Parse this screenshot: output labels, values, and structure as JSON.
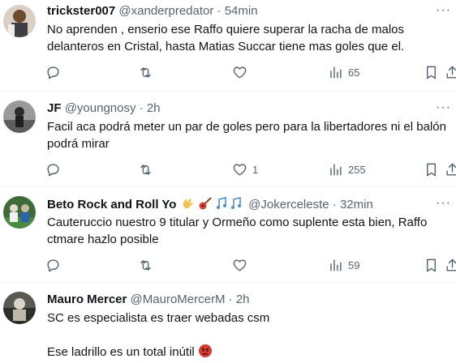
{
  "tweets": [
    {
      "name": "trickster007",
      "handle": "@xanderpredator",
      "dot": "·",
      "time": "54min",
      "text": "No aprenden , enserio ese Raffo quiere superar la racha de malos delanteros en Cristal, hasta Matias Succar tiene mas goles que el.",
      "likes": "",
      "views": "65"
    },
    {
      "name": "JF",
      "handle": "@youngnosy",
      "dot": "·",
      "time": "2h",
      "text": "Facil aca podrá meter un par de goles pero para la libertadores ni el balón podrá mirar",
      "likes": "1",
      "views": "255"
    },
    {
      "name": "Beto Rock and Roll Yo",
      "handle": "@Jokerceleste",
      "dot": "·",
      "time": "32min",
      "text": "Cauteruccio nuestro 9 titular y Ormeño como suplente esta bien, Raffo ctmare hazlo posible",
      "likes": "",
      "views": "59"
    },
    {
      "name": "Mauro Mercer",
      "handle": "@MauroMercerM",
      "dot": "·",
      "time": "2h",
      "text": "SC es especialista es traer webadas csm",
      "text2": "Ese ladrillo es un total inútil"
    }
  ],
  "icons": {
    "reply": "reply-icon",
    "retweet": "retweet-icon",
    "like": "heart-icon",
    "views": "views-icon",
    "bookmark": "bookmark-icon",
    "share": "share-icon",
    "more": "more-icon"
  }
}
